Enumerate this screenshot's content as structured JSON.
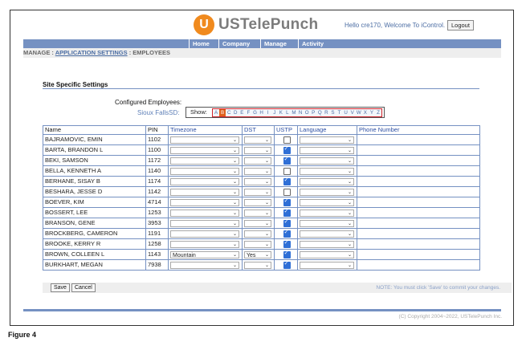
{
  "header": {
    "logo_mark": "U",
    "logo_text": "USTelePunch",
    "welcome": "Hello cre170, Welcome To iControl.",
    "logout_label": "Logout"
  },
  "nav": [
    "Home",
    "Company",
    "Manage",
    "Activity"
  ],
  "breadcrumb": {
    "manage": "MANAGE",
    "sep": " : ",
    "application_settings": "APPLICATION SETTINGS",
    "employees": "EMPLOYEES"
  },
  "section_title": "Site Specific Settings",
  "configured_label": "Configured Employees:",
  "site_label": "Sioux FallsSD:",
  "show_label": "Show:",
  "letters": [
    "A",
    "B",
    "C",
    "D",
    "E",
    "F",
    "G",
    "H",
    "I",
    "J",
    "K",
    "L",
    "M",
    "N",
    "O",
    "P",
    "Q",
    "R",
    "S",
    "T",
    "U",
    "V",
    "W",
    "X",
    "Y",
    "Z"
  ],
  "active_letter": "B",
  "columns": {
    "name": "Name",
    "pin": "PIN",
    "timezone": "Timezone",
    "dst": "DST",
    "ustp": "USTP",
    "language": "Language",
    "phone": "Phone Number"
  },
  "employees": [
    {
      "name": "BAJRAMOVIC, EMIN",
      "pin": "1102",
      "timezone": "",
      "dst": "",
      "ustp": false,
      "language": "",
      "phone": ""
    },
    {
      "name": "BARTA, BRANDON L",
      "pin": "1100",
      "timezone": "",
      "dst": "",
      "ustp": true,
      "language": "",
      "phone": ""
    },
    {
      "name": "BEKI, SAMSON",
      "pin": "1172",
      "timezone": "",
      "dst": "",
      "ustp": true,
      "language": "",
      "phone": ""
    },
    {
      "name": "BELLA, KENNETH A",
      "pin": "1140",
      "timezone": "",
      "dst": "",
      "ustp": false,
      "language": "",
      "phone": ""
    },
    {
      "name": "BERHANE, SISAY B",
      "pin": "1174",
      "timezone": "",
      "dst": "",
      "ustp": true,
      "language": "",
      "phone": ""
    },
    {
      "name": "BESHARA, JESSE D",
      "pin": "1142",
      "timezone": "",
      "dst": "",
      "ustp": false,
      "language": "",
      "phone": ""
    },
    {
      "name": "BOEVER, KIM",
      "pin": "4714",
      "timezone": "",
      "dst": "",
      "ustp": true,
      "language": "",
      "phone": ""
    },
    {
      "name": "BOSSERT, LEE",
      "pin": "1253",
      "timezone": "",
      "dst": "",
      "ustp": true,
      "language": "",
      "phone": ""
    },
    {
      "name": "BRANSON, GENE",
      "pin": "3953",
      "timezone": "",
      "dst": "",
      "ustp": true,
      "language": "",
      "phone": ""
    },
    {
      "name": "BROCKBERG, CAMERON",
      "pin": "1191",
      "timezone": "",
      "dst": "",
      "ustp": true,
      "language": "",
      "phone": ""
    },
    {
      "name": "BROOKE, KERRY R",
      "pin": "1258",
      "timezone": "",
      "dst": "",
      "ustp": true,
      "language": "",
      "phone": ""
    },
    {
      "name": "BROWN, COLLEEN L",
      "pin": "1143",
      "timezone": "Mountain",
      "dst": "Yes",
      "ustp": true,
      "language": "",
      "phone": ""
    },
    {
      "name": "BURKHART, MEGAN",
      "pin": "7938",
      "timezone": "",
      "dst": "",
      "ustp": true,
      "language": "",
      "phone": ""
    }
  ],
  "save_label": "Save",
  "cancel_label": "Cancel",
  "note": "NOTE: You must click 'Save' to commit your changes.",
  "copyright": "(C) Copyright 2004~2022, USTelePunch Inc.",
  "figure_caption": "Figure 4",
  "colors": {
    "accent_blue": "#7591c2",
    "logo_orange": "#f08a1e",
    "active_letter": "#e0601c",
    "letter_border": "#d0232a"
  }
}
